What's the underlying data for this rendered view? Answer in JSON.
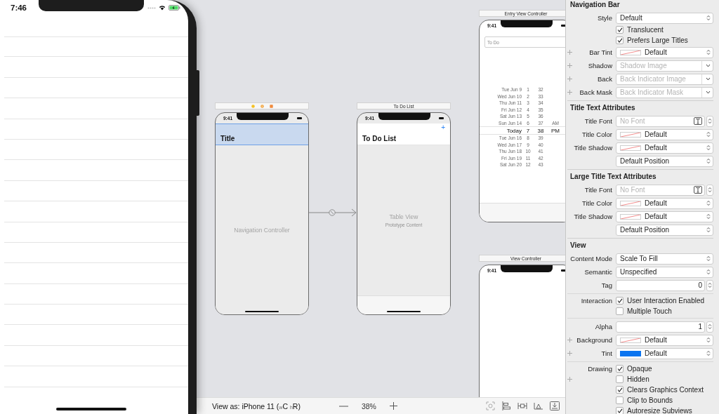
{
  "simulator": {
    "time": "7:46"
  },
  "scenes": [
    {
      "kind": "navigation",
      "time": "9:41",
      "nav_bar": {
        "title": "Title",
        "selected": true
      },
      "center_label": "Navigation Controller"
    },
    {
      "kind": "table",
      "header": "To Do List",
      "time": "9:41",
      "nav_bar": {
        "title": "To Do List",
        "selected": false,
        "add_button": "+"
      },
      "center_label": "Table View",
      "sub_label": "Prototype Content"
    },
    {
      "kind": "entry",
      "header": "Entry View Controller",
      "time": "9:41",
      "field": {
        "placeholder": "To Do"
      },
      "picker": [
        {
          "date": "Tue Jun 9",
          "hour": "1",
          "minute": "32",
          "selected": false
        },
        {
          "date": "Wed Jun 10",
          "hour": "2",
          "minute": "33",
          "selected": false
        },
        {
          "date": "Thu Jun 11",
          "hour": "3",
          "minute": "34",
          "selected": false
        },
        {
          "date": "Fri Jun 12",
          "hour": "4",
          "minute": "35",
          "selected": false
        },
        {
          "date": "Sat Jun 13",
          "hour": "5",
          "minute": "36",
          "selected": false
        },
        {
          "date": "Sun Jun 14",
          "hour": "6",
          "minute": "37",
          "period": "AM",
          "selected": false
        },
        {
          "date": "Today",
          "hour": "7",
          "minute": "38",
          "period": "PM",
          "selected": true
        },
        {
          "date": "Tue Jun 16",
          "hour": "8",
          "minute": "39",
          "selected": false
        },
        {
          "date": "Wed Jun 17",
          "hour": "9",
          "minute": "40",
          "selected": false
        },
        {
          "date": "Thu Jun 18",
          "hour": "10",
          "minute": "41",
          "selected": false
        },
        {
          "date": "Fri Jun 19",
          "hour": "11",
          "minute": "42",
          "selected": false
        },
        {
          "date": "Sat Jun 20",
          "hour": "12",
          "minute": "43",
          "selected": false
        }
      ]
    },
    {
      "kind": "plain",
      "header": "View Controller",
      "time": "9:41"
    }
  ],
  "bottom_bar": {
    "device": "View as: iPhone 11 ($_{w}$C $_{h}$R)",
    "zoom": "38%"
  },
  "inspector": {
    "sections": [
      {
        "title": "Navigation Bar",
        "groups": [
          {
            "rows": [
              {
                "kind": "select",
                "label": "Style",
                "value": "Default"
              },
              {
                "kind": "checkbox",
                "text": "Translucent",
                "checked": true
              },
              {
                "kind": "checkbox",
                "text": "Prefers Large Titles",
                "checked": true
              },
              {
                "kind": "color_select",
                "label": "Bar Tint",
                "value": "Default",
                "variations": true
              },
              {
                "kind": "image_select",
                "label": "Shadow",
                "placeholder": "Shadow Image",
                "variations": true
              },
              {
                "kind": "image_select",
                "label": "Back",
                "placeholder": "Back Indicator Image",
                "variations": true
              },
              {
                "kind": "image_select",
                "label": "Back Mask",
                "placeholder": "Back Indicator Mask",
                "variations": true
              }
            ]
          }
        ]
      },
      {
        "title": "Title Text Attributes",
        "groups": [
          {
            "rows": [
              {
                "kind": "font",
                "label": "Title Font",
                "placeholder": "No Font"
              },
              {
                "kind": "color_select",
                "label": "Title Color",
                "value": "Default"
              },
              {
                "kind": "color_select",
                "label": "Title Shadow",
                "value": "Default"
              },
              {
                "kind": "select",
                "value": "Default Position"
              }
            ]
          }
        ]
      },
      {
        "title": "Large Title Text Attributes",
        "groups": [
          {
            "rows": [
              {
                "kind": "font",
                "label": "Title Font",
                "placeholder": "No Font"
              },
              {
                "kind": "color_select",
                "label": "Title Color",
                "value": "Default"
              },
              {
                "kind": "color_select",
                "label": "Title Shadow",
                "value": "Default"
              },
              {
                "kind": "select",
                "value": "Default Position"
              }
            ]
          }
        ]
      },
      {
        "title": "View",
        "groups": [
          {
            "rows": [
              {
                "kind": "select",
                "label": "Content Mode",
                "value": "Scale To Fill"
              },
              {
                "kind": "select",
                "label": "Semantic",
                "value": "Unspecified"
              },
              {
                "kind": "number",
                "label": "Tag",
                "value": "0"
              }
            ]
          },
          {
            "rows": [
              {
                "kind": "checkbox",
                "label": "Interaction",
                "text": "User Interaction Enabled",
                "checked": true
              },
              {
                "kind": "checkbox",
                "text": "Multiple Touch",
                "checked": false
              }
            ]
          },
          {
            "rows": [
              {
                "kind": "number",
                "label": "Alpha",
                "value": "1"
              },
              {
                "kind": "color_select",
                "label": "Background",
                "value": "Default",
                "variations": true
              },
              {
                "kind": "color_select",
                "label": "Tint",
                "value": "Default",
                "color": "#0a74f0",
                "variations": true
              }
            ]
          },
          {
            "rows": [
              {
                "kind": "checkbox",
                "label": "Drawing",
                "text": "Opaque",
                "checked": true
              },
              {
                "kind": "checkbox",
                "text": "Hidden",
                "checked": false,
                "variations": true
              },
              {
                "kind": "checkbox",
                "text": "Clears Graphics Context",
                "checked": true
              },
              {
                "kind": "checkbox",
                "text": "Clip to Bounds",
                "checked": false
              },
              {
                "kind": "checkbox",
                "text": "Autoresize Subviews",
                "checked": true
              }
            ]
          }
        ]
      }
    ]
  }
}
